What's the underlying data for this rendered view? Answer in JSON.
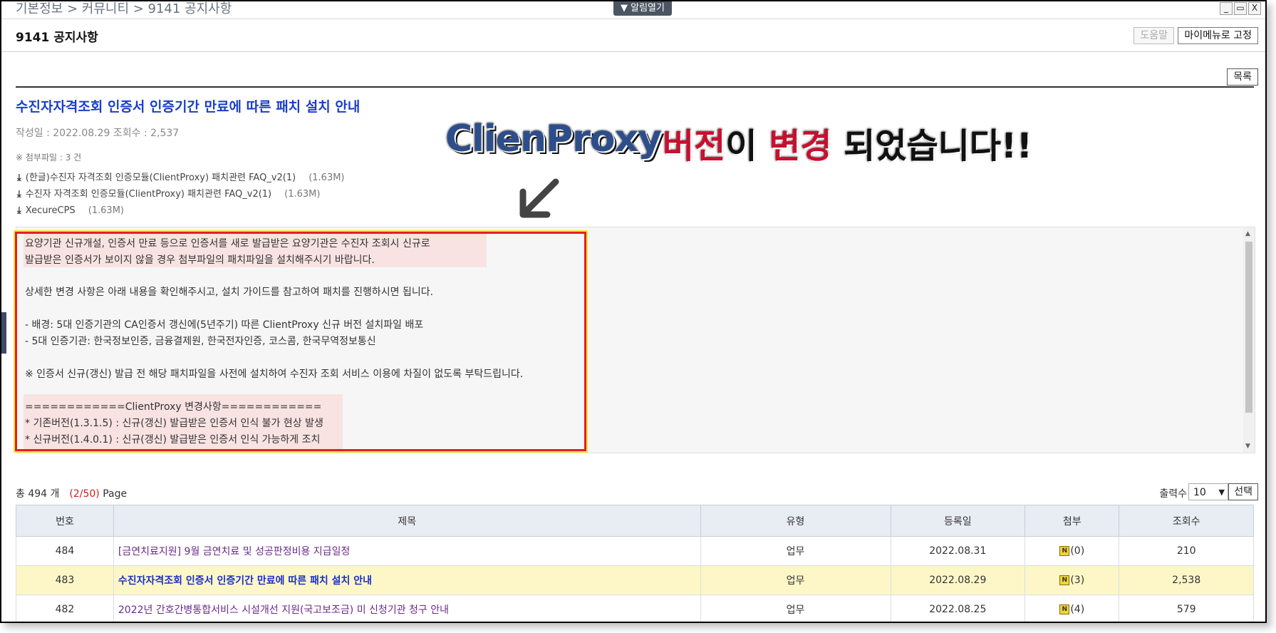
{
  "topbar": {
    "breadcrumb": "기본정보 > 커뮤니티 > 9141 공지사항",
    "alarm_label": "▼ 알림열기",
    "minimize": "_",
    "restore": "▭",
    "close": "X"
  },
  "header": {
    "title": "9141 공지사항",
    "help_label": "도움말",
    "mymenu_label": "마이메뉴로 고정"
  },
  "notice": {
    "list_label": "목록",
    "title": "수진자자격조회 인증서 인증기간 만료에 따른 패치 설치 안내",
    "meta": "작성일 : 2022.08.29    조회수 : 2,537",
    "attach_count": "※ 첨부파일 : 3 건",
    "files": [
      {
        "name": "(한글)수진자 자격조회 인증모듈(ClientProxy) 패치관련 FAQ_v2(1)",
        "size": "(1.63M)"
      },
      {
        "name": "수진자 자격조회 인증모듈(ClientProxy) 패치관련 FAQ_v2(1)",
        "size": "(1.63M)"
      },
      {
        "name": "XecureCPS",
        "size": "(1.63M)"
      }
    ],
    "content_lines": [
      "요양기관 신규개설, 인증서 만료 등으로 인증서를 새로 발급받은 요양기관은 수진자 조회시 신규로",
      "발급받은 인증서가 보이지 않을 경우 첨부파일의 패치파일을 설치해주시기 바랍니다.",
      "상세한 변경 사항은 아래 내용을 확인해주시고, 설치 가이드를 참고하여 패치를 진행하시면 됩니다.",
      "- 배경: 5대 인증기관의 CA인증서 갱신에(5년주기) 따른 ClientProxy 신규 버전 설치파일 배포",
      "- 5대 인증기관: 한국정보인증, 금융결제원, 한국전자인증, 코스콤, 한국무역정보통신",
      "※ 인증서 신규(갱신) 발급 전 해당 패치파일을 사전에 설치하여 수진자 조회 서비스 이용에 차질이 없도록 부탁드립니다.",
      "============ClientProxy 변경사항============",
      "* 기존버전(1.3.1.5) : 신규(갱신) 발급받은 인증서 인식 불가 현상 발생",
      "* 신규버전(1.4.0.1) : 신규(갱신) 발급받은 인증서 인식 가능하게 조치"
    ]
  },
  "annotation": {
    "title": "ClienProxy",
    "word1": "버전",
    "word2": "이",
    "word3": "변경",
    "word4": "되었습니다!!"
  },
  "list": {
    "total": "총 494 개",
    "page": "(2/50)",
    "page_suffix": "Page",
    "rows_label": "출력수",
    "rows_value": "10",
    "select_label": "선택",
    "columns": [
      "번호",
      "제목",
      "유형",
      "등록일",
      "첨부",
      "조회수"
    ],
    "rows": [
      {
        "no": "484",
        "title": "[금연치료지원] 9월 금연치료 및 성공판정비용 지급일정",
        "type": "업무",
        "date": "2022.08.31",
        "attach": "(0)",
        "views": "210"
      },
      {
        "no": "483",
        "title": "수진자자격조회 인증서 인증기간 만료에 따른 패치 설치 안내",
        "type": "업무",
        "date": "2022.08.29",
        "attach": "(3)",
        "views": "2,538"
      },
      {
        "no": "482",
        "title": "2022년 간호간병통합서비스 시설개선 지원(국고보조금) 미 신청기관 청구 안내",
        "type": "업무",
        "date": "2022.08.25",
        "attach": "(4)",
        "views": "579"
      }
    ],
    "badge": "N"
  },
  "colors": {
    "title_blue": "#1a3ec8",
    "highlight_red": "#e52020",
    "selected_row": "#fdf7c8",
    "header_bg": "#e8edf4"
  }
}
